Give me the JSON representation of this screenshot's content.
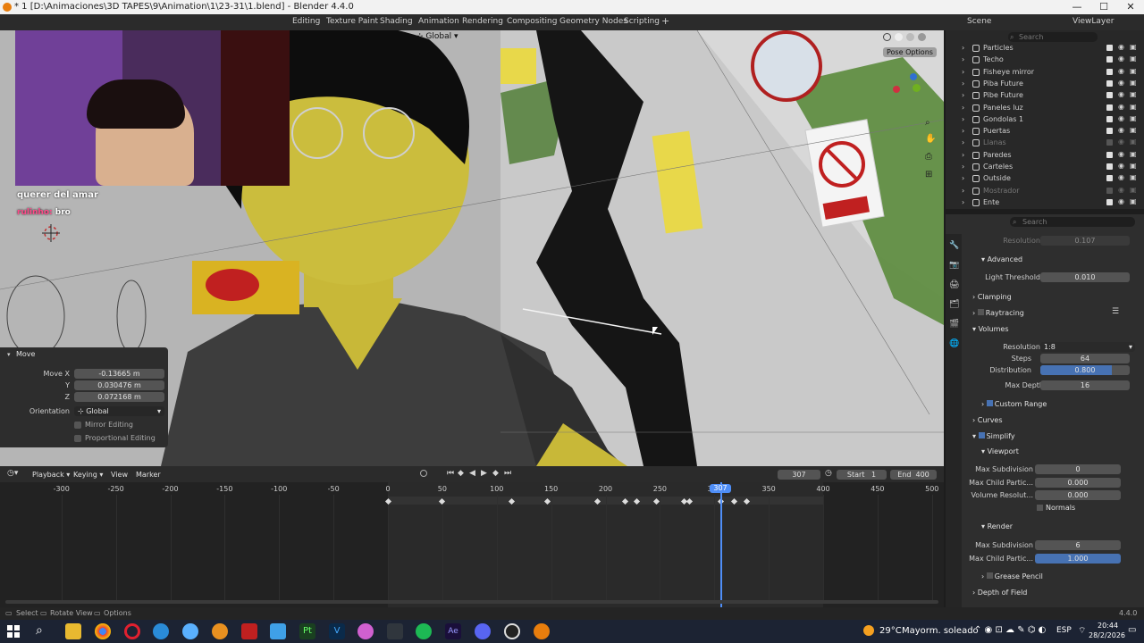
{
  "window": {
    "title": "* 1 [D:\\Animaciones\\3D TAPES\\9\\Animation\\1\\23-31\\1.blend] - Blender 4.4.0",
    "minimize": "—",
    "maximize": "☐",
    "close": "✕"
  },
  "menu": {
    "workspaces": [
      "Editing",
      "Texture Paint",
      "Shading",
      "Animation",
      "Rendering",
      "Compositing",
      "Geometry Nodes",
      "Scripting"
    ],
    "add": "+",
    "scene": "Scene",
    "viewlayer": "ViewLayer"
  },
  "viewport": {
    "orientation": "Global",
    "pose_options": "Pose Options"
  },
  "stream": {
    "song": "querer del amar",
    "chat_user": "rulinho:",
    "chat_msg": "bro"
  },
  "move_panel": {
    "title": "Move",
    "move_x_label": "Move X",
    "move_x": "-0.13665 m",
    "y_label": "Y",
    "y": "0.030476 m",
    "z_label": "Z",
    "z": "0.072168 m",
    "orientation_label": "Orientation",
    "orientation": "Global",
    "mirror": "Mirror Editing",
    "proportional": "Proportional Editing"
  },
  "outliner": {
    "search_placeholder": "Search",
    "items": [
      {
        "name": "Particles",
        "dim": false
      },
      {
        "name": "Techo",
        "dim": false
      },
      {
        "name": "Fisheye mirror",
        "dim": false
      },
      {
        "name": "Piba Future",
        "dim": false
      },
      {
        "name": "Pibe Future",
        "dim": false
      },
      {
        "name": "Paneles luz",
        "dim": false
      },
      {
        "name": "Gondolas 1",
        "dim": false
      },
      {
        "name": "Puertas",
        "dim": false
      },
      {
        "name": "Llanas",
        "dim": true
      },
      {
        "name": "Paredes",
        "dim": false
      },
      {
        "name": "Carteles",
        "dim": false
      },
      {
        "name": "Outside",
        "dim": false
      },
      {
        "name": "Mostrador",
        "dim": true
      },
      {
        "name": "Ente",
        "dim": false
      }
    ]
  },
  "properties": {
    "search_placeholder": "Search",
    "resolution_top_label": "Resolution",
    "resolution_top": "0.107",
    "advanced": "Advanced",
    "light_threshold_label": "Light Threshold",
    "light_threshold": "0.010",
    "clamping": "Clamping",
    "raytracing": "Raytracing",
    "volumes": "Volumes",
    "vol_resolution_label": "Resolution",
    "vol_resolution": "1:8",
    "steps_label": "Steps",
    "steps": "64",
    "distribution_label": "Distribution",
    "distribution": "0.800",
    "distribution_fill": 0.8,
    "max_depth_label": "Max Depth",
    "max_depth": "16",
    "custom_range": "Custom Range",
    "curves": "Curves",
    "simplify": "Simplify",
    "viewport": "Viewport",
    "max_subdiv_label": "Max Subdivision",
    "max_subdiv": "0",
    "max_child_label": "Max Child Partic...",
    "max_child": "0.000",
    "vol_res_label": "Volume Resolut...",
    "vol_res": "0.000",
    "normals": "Normals",
    "render": "Render",
    "r_max_subdiv_label": "Max Subdivision",
    "r_max_subdiv": "6",
    "r_max_child_label": "Max Child Partic...",
    "r_max_child": "1.000",
    "grease_pencil": "Grease Pencil",
    "depth_of_field": "Depth of Field"
  },
  "timeline": {
    "playback": "Playback",
    "keying": "Keying",
    "view": "View",
    "marker": "Marker",
    "current_frame": "307",
    "start_label": "Start",
    "start": "1",
    "end_label": "End",
    "end": "400",
    "ticks": [
      "-300",
      "-250",
      "-200",
      "-150",
      "-100",
      "-50",
      "0",
      "50",
      "100",
      "150",
      "200",
      "250",
      "300",
      "350",
      "400",
      "450",
      "500"
    ],
    "keyframes": [
      0,
      50,
      114,
      147,
      193,
      218,
      229,
      247,
      272,
      277,
      306,
      318,
      330
    ]
  },
  "status": {
    "select": "Select",
    "rotate": "Rotate View",
    "options": "Options",
    "version": "4.4.0"
  },
  "taskbar": {
    "weather_temp": "29°C",
    "weather_desc": "Mayorm. soleado",
    "lang": "ESP",
    "time": "20:44",
    "date": "28/2/2026"
  }
}
